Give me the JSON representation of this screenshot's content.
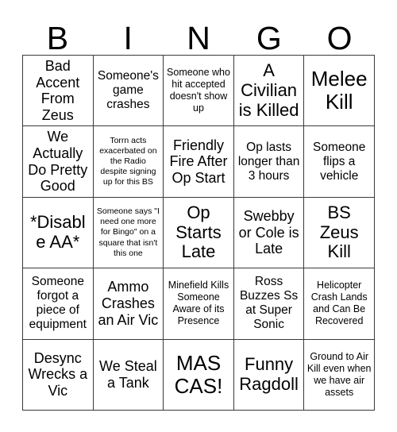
{
  "card": {
    "title_letters": [
      "B",
      "I",
      "N",
      "G",
      "O"
    ],
    "grid_size": "5x5"
  },
  "cells": [
    {
      "row": 1,
      "col": 1,
      "text": "Bad Accent From Zeus",
      "size": "lg"
    },
    {
      "row": 1,
      "col": 2,
      "text": "Someone's game crashes",
      "size": "md"
    },
    {
      "row": 1,
      "col": 3,
      "text": "Someone who hit accepted doesn't show up",
      "size": "sm"
    },
    {
      "row": 1,
      "col": 4,
      "text": "A Civilian is Killed",
      "size": "xl"
    },
    {
      "row": 1,
      "col": 5,
      "text": "Melee Kill",
      "size": "xxl"
    },
    {
      "row": 2,
      "col": 1,
      "text": "We Actually Do Pretty Good",
      "size": "lg"
    },
    {
      "row": 2,
      "col": 2,
      "text": "Torrn acts exacerbated on the Radio despite signing up for this BS",
      "size": "xs"
    },
    {
      "row": 2,
      "col": 3,
      "text": "Friendly Fire After Op Start",
      "size": "lg"
    },
    {
      "row": 2,
      "col": 4,
      "text": "Op lasts longer than 3 hours",
      "size": "md"
    },
    {
      "row": 2,
      "col": 5,
      "text": "Someone flips a vehicle",
      "size": "md"
    },
    {
      "row": 3,
      "col": 1,
      "text": "*Disable AA*",
      "size": "xl"
    },
    {
      "row": 3,
      "col": 2,
      "text": "Someone says \"I need one more for Bingo\" on a square that isn't this one",
      "size": "xs"
    },
    {
      "row": 3,
      "col": 3,
      "text": "Op Starts Late",
      "size": "xl"
    },
    {
      "row": 3,
      "col": 4,
      "text": "Swebby or Cole is Late",
      "size": "lg"
    },
    {
      "row": 3,
      "col": 5,
      "text": "BS Zeus Kill",
      "size": "xl"
    },
    {
      "row": 4,
      "col": 1,
      "text": "Someone forgot a piece of equipment",
      "size": "md"
    },
    {
      "row": 4,
      "col": 2,
      "text": "Ammo Crashes an Air Vic",
      "size": "lg"
    },
    {
      "row": 4,
      "col": 3,
      "text": "Minefield Kills Someone Aware of its Presence",
      "size": "sm"
    },
    {
      "row": 4,
      "col": 4,
      "text": "Ross Buzzes Ss at Super Sonic",
      "size": "md"
    },
    {
      "row": 4,
      "col": 5,
      "text": "Helicopter Crash Lands and Can Be Recovered",
      "size": "sm"
    },
    {
      "row": 5,
      "col": 1,
      "text": "Desync Wrecks a Vic",
      "size": "lg"
    },
    {
      "row": 5,
      "col": 2,
      "text": "We Steal a Tank",
      "size": "lg"
    },
    {
      "row": 5,
      "col": 3,
      "text": "MAS CAS!",
      "size": "xxl"
    },
    {
      "row": 5,
      "col": 4,
      "text": "Funny Ragdoll",
      "size": "xl"
    },
    {
      "row": 5,
      "col": 5,
      "text": "Ground to Air Kill even when we have air assets",
      "size": "sm"
    }
  ],
  "colors": {
    "background": "#ffffff",
    "text": "#000000",
    "grid_line": "#3a3a3a"
  }
}
